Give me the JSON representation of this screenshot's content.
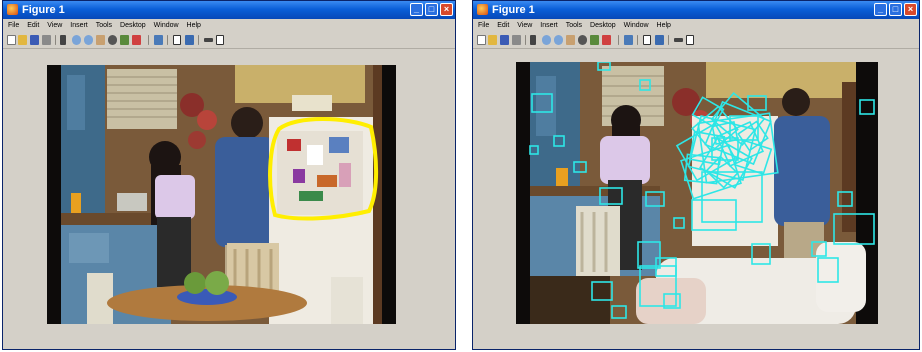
{
  "left_window": {
    "title": "Figure 1",
    "menu": [
      "File",
      "Edit",
      "View",
      "Insert",
      "Tools",
      "Desktop",
      "Window",
      "Help"
    ],
    "highlight_color": "#ffee00"
  },
  "right_window": {
    "title": "Figure 1",
    "menu": [
      "File",
      "Edit",
      "View",
      "Insert",
      "Tools",
      "Desktop",
      "Window",
      "Help"
    ],
    "box_color": "#2ee6e6"
  },
  "icons": [
    "new-file-icon",
    "open-icon",
    "save-icon",
    "print-icon",
    "pointer-icon",
    "zoom-in-icon",
    "zoom-out-icon",
    "pan-icon",
    "rotate-icon",
    "data-cursor-icon",
    "brush-icon",
    "colorbar-icon",
    "legend-icon",
    "grid-icon",
    "plot-tools-icon"
  ]
}
